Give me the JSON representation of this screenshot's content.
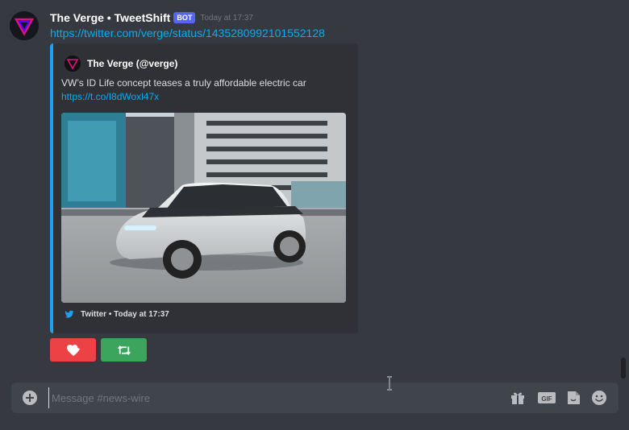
{
  "message": {
    "author": "The Verge • TweetShift",
    "bot_tag": "BOT",
    "timestamp": "Today at 17:37",
    "link": "https://twitter.com/verge/status/1435280992101552128"
  },
  "embed": {
    "accent_color": "#1da1f2",
    "author": "The Verge (@verge)",
    "description": "VW’s ID Life concept teases a truly affordable electric car",
    "link": "https://t.co/I8dWoxl47x",
    "footer": "Twitter • Today at 17:37",
    "footer_icon": "twitter-bird-icon"
  },
  "buttons": [
    {
      "icon": "heart-icon",
      "color": "#ed4245"
    },
    {
      "icon": "retweet-icon",
      "color": "#3ba55d"
    }
  ],
  "composer": {
    "placeholder": "Message #news-wire",
    "gif_label": "GIF",
    "icons": [
      "add-circle-icon",
      "gift-icon",
      "gif-icon",
      "sticker-icon",
      "emoji-icon"
    ]
  }
}
